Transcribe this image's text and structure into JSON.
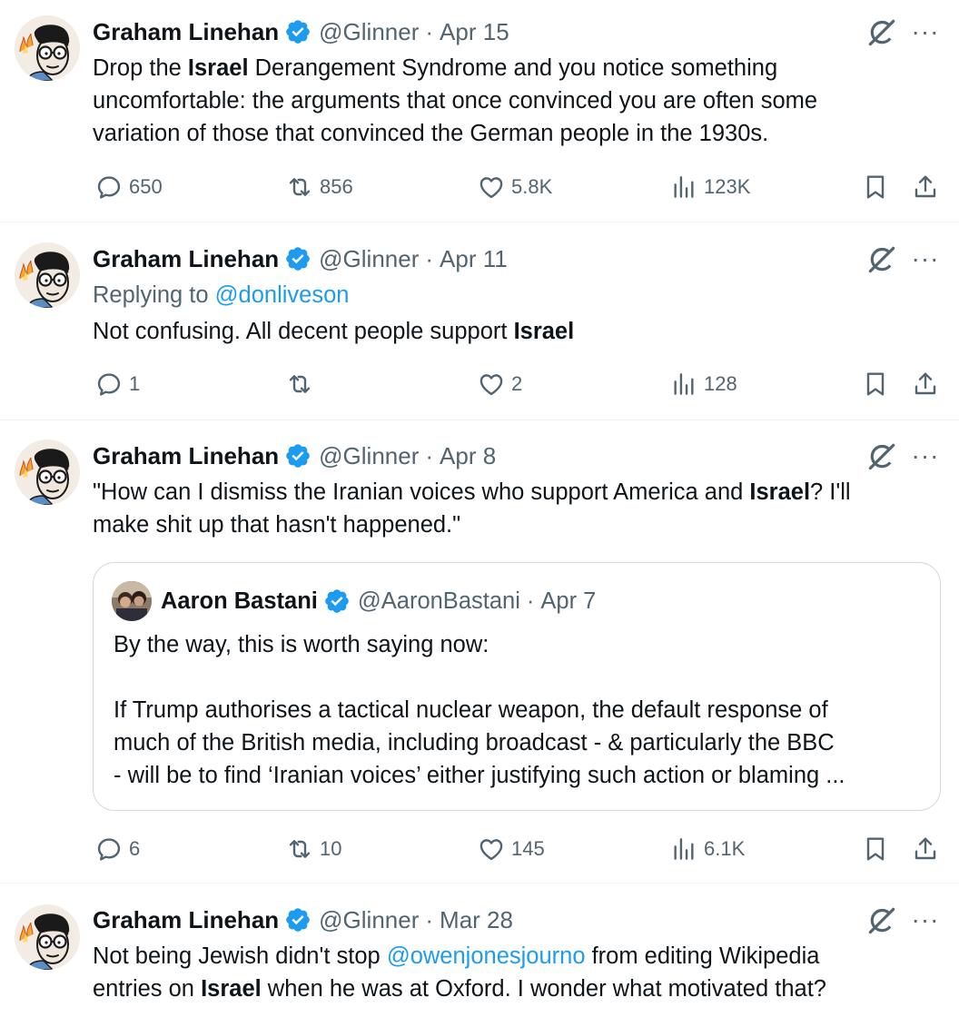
{
  "tweets": [
    {
      "name": "Graham Linehan",
      "handle": "@Glinner",
      "dot": "·",
      "date": "Apr 15",
      "lines": [
        {
          "pre": "Drop the ",
          "bold": "Israel",
          "post": " Derangement Syndrome and you notice something"
        },
        {
          "pre": "uncomfortable: the arguments that once convinced you are often some",
          "bold": "",
          "post": ""
        },
        {
          "pre": "variation of those that convinced the German people in the 1930s.",
          "bold": "",
          "post": ""
        }
      ],
      "replies": "650",
      "reposts": "856",
      "likes": "5.8K",
      "views": "123K"
    },
    {
      "name": "Graham Linehan",
      "handle": "@Glinner",
      "dot": "·",
      "date": "Apr 11",
      "replying_prefix": "Replying to ",
      "replying_to": "@donliveson",
      "line": {
        "pre": "Not confusing. All decent people support ",
        "bold": "Israel"
      },
      "replies": "1",
      "reposts": "",
      "likes": "2",
      "views": "128"
    },
    {
      "name": "Graham Linehan",
      "handle": "@Glinner",
      "dot": "·",
      "date": "Apr 8",
      "lines": [
        {
          "pre": "\"How can I dismiss the Iranian voices who support America and ",
          "bold": "Israel",
          "post": "? I'll"
        },
        {
          "pre": "make shit up that hasn't happened.\"",
          "bold": "",
          "post": ""
        }
      ],
      "quote": {
        "name": "Aaron Bastani",
        "handle": "@AaronBastani",
        "dot": "·",
        "date": "Apr 7",
        "line1": "By the way, this is worth saying now:",
        "line2": "If Trump authorises a tactical nuclear weapon, the default response of",
        "line3": "much of the British media, including broadcast - & particularly the BBC",
        "line4": "- will be to find ‘Iranian voices’ either justifying such action or blaming ..."
      },
      "replies": "6",
      "reposts": "10",
      "likes": "145",
      "views": "6.1K"
    },
    {
      "name": "Graham Linehan",
      "handle": "@Glinner",
      "dot": "·",
      "date": "Mar 28",
      "line1_pre": "Not being Jewish didn't stop ",
      "line1_link": "@owenjonesjourno",
      "line1_post": " from editing Wikipedia",
      "line2_pre": "entries on ",
      "line2_bold": "Israel",
      "line2_post": " when he was at Oxford. I wonder what motivated that?"
    }
  ],
  "more_label": "···",
  "icons": {
    "verified": "verified-badge-icon",
    "grok": "grok-icon",
    "reply": "reply-icon",
    "repost": "repost-icon",
    "like": "heart-icon",
    "views": "views-icon",
    "bookmark": "bookmark-icon",
    "share": "share-icon"
  },
  "colors": {
    "accent": "#1d9bf0",
    "secondary_text": "#536471",
    "primary_text": "#0f1419",
    "border": "#eff3f4"
  }
}
